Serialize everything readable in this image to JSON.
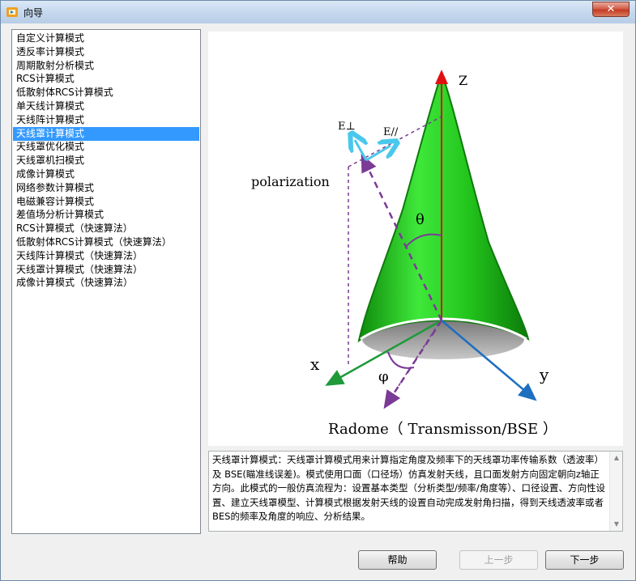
{
  "window": {
    "title": "向导",
    "close_label": "✕"
  },
  "mode_list": {
    "items": [
      "自定义计算模式",
      "透反率计算模式",
      "周期散射分析模式",
      "RCS计算模式",
      "低散射体RCS计算模式",
      "单天线计算模式",
      "天线阵计算模式",
      "天线罩计算模式",
      "天线罩优化模式",
      "天线罩机扫模式",
      "成像计算模式",
      "网络参数计算模式",
      "电磁兼容计算模式",
      "差值场分析计算模式",
      "RCS计算模式（快速算法）",
      "低散射体RCS计算模式（快速算法）",
      "天线阵计算模式（快速算法）",
      "天线罩计算模式（快速算法）",
      "成像计算模式（快速算法）"
    ],
    "selected_index": 7
  },
  "figure": {
    "z_label": "Z",
    "x_label": "x",
    "y_label": "y",
    "e_perp_label": "E⊥",
    "e_par_label": "E//",
    "polarization_label": "polarization",
    "theta_label": "θ",
    "phi_label": "φ",
    "caption": "Radome（ Transmisson/BSE ）",
    "colors": {
      "cone": "#22c41c",
      "cone_edge": "#0e7a0c",
      "z_axis": "#e01010",
      "x_axis": "#1e9a3a",
      "y_axis": "#1e6fc0",
      "wave": "#7b3a96",
      "efield": "#4ac8ec"
    }
  },
  "description": {
    "text": "天线罩计算模式：天线罩计算模式用来计算指定角度及频率下的天线罩功率传输系数（透波率）及 BSE(瞄准线误差)。模式使用口面（口径场）仿真发射天线，且口面发射方向固定朝向z轴正方向。此模式的一般仿真流程为：设置基本类型（分析类型/频率/角度等）、口径设置、方向性设置、建立天线罩模型、计算模式根据发射天线的设置自动完成发射角扫描，得到天线透波率或者BES的频率及角度的响应、分析结果。"
  },
  "buttons": {
    "help": "帮助",
    "prev": "上一步",
    "next": "下一步"
  }
}
